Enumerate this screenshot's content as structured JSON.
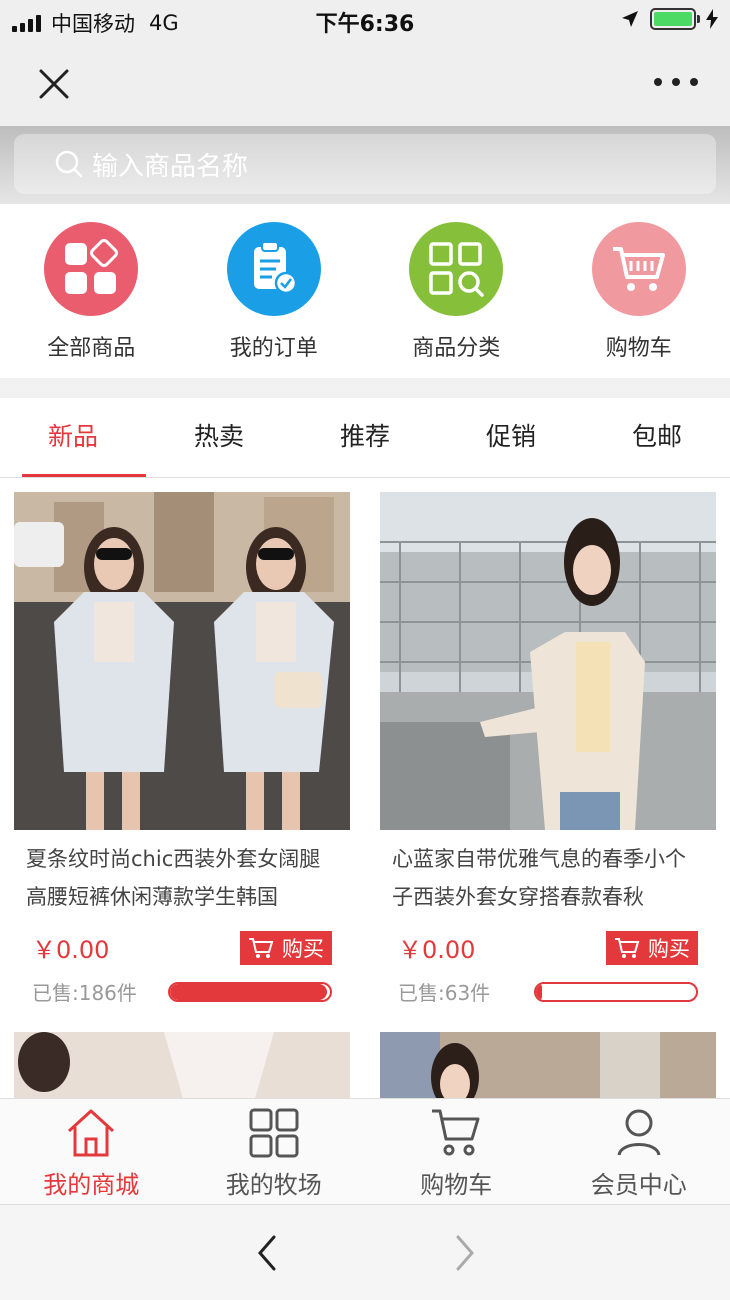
{
  "status_bar": {
    "carrier": "中国移动",
    "network": "4G",
    "time": "下午6:36"
  },
  "nav": {
    "close_icon": "close-icon",
    "more_icon": "more-icon"
  },
  "search": {
    "placeholder": "输入商品名称"
  },
  "shortcuts": [
    {
      "label": "全部商品",
      "icon": "grid-diamond-icon",
      "color": "#ea5d6e"
    },
    {
      "label": "我的订单",
      "icon": "clipboard-check-icon",
      "color": "#1a9ee6"
    },
    {
      "label": "商品分类",
      "icon": "category-search-icon",
      "color": "#86c03a"
    },
    {
      "label": "购物车",
      "icon": "cart-icon",
      "color": "#f09aa0"
    }
  ],
  "tabs": [
    {
      "label": "新品",
      "active": true
    },
    {
      "label": "热卖"
    },
    {
      "label": "推荐"
    },
    {
      "label": "促销"
    },
    {
      "label": "包邮"
    }
  ],
  "products": [
    {
      "title": "夏条纹时尚chic西装外套女阔腿高腰短裤休闲薄款学生韩国",
      "price": "￥0.00",
      "buy_label": "购买",
      "sold": "已售:186件",
      "progress": 0.98
    },
    {
      "title": "心蓝家自带优雅气息的春季小个子西装外套女穿搭春款春秋",
      "price": "￥0.00",
      "buy_label": "购买",
      "sold": "已售:63件",
      "progress": 0.04
    }
  ],
  "tabbar": [
    {
      "label": "我的商城",
      "icon": "home-icon",
      "active": true
    },
    {
      "label": "我的牧场",
      "icon": "grid-icon"
    },
    {
      "label": "购物车",
      "icon": "cart-icon"
    },
    {
      "label": "会员中心",
      "icon": "user-icon"
    }
  ],
  "colors": {
    "accent": "#e4393c"
  }
}
